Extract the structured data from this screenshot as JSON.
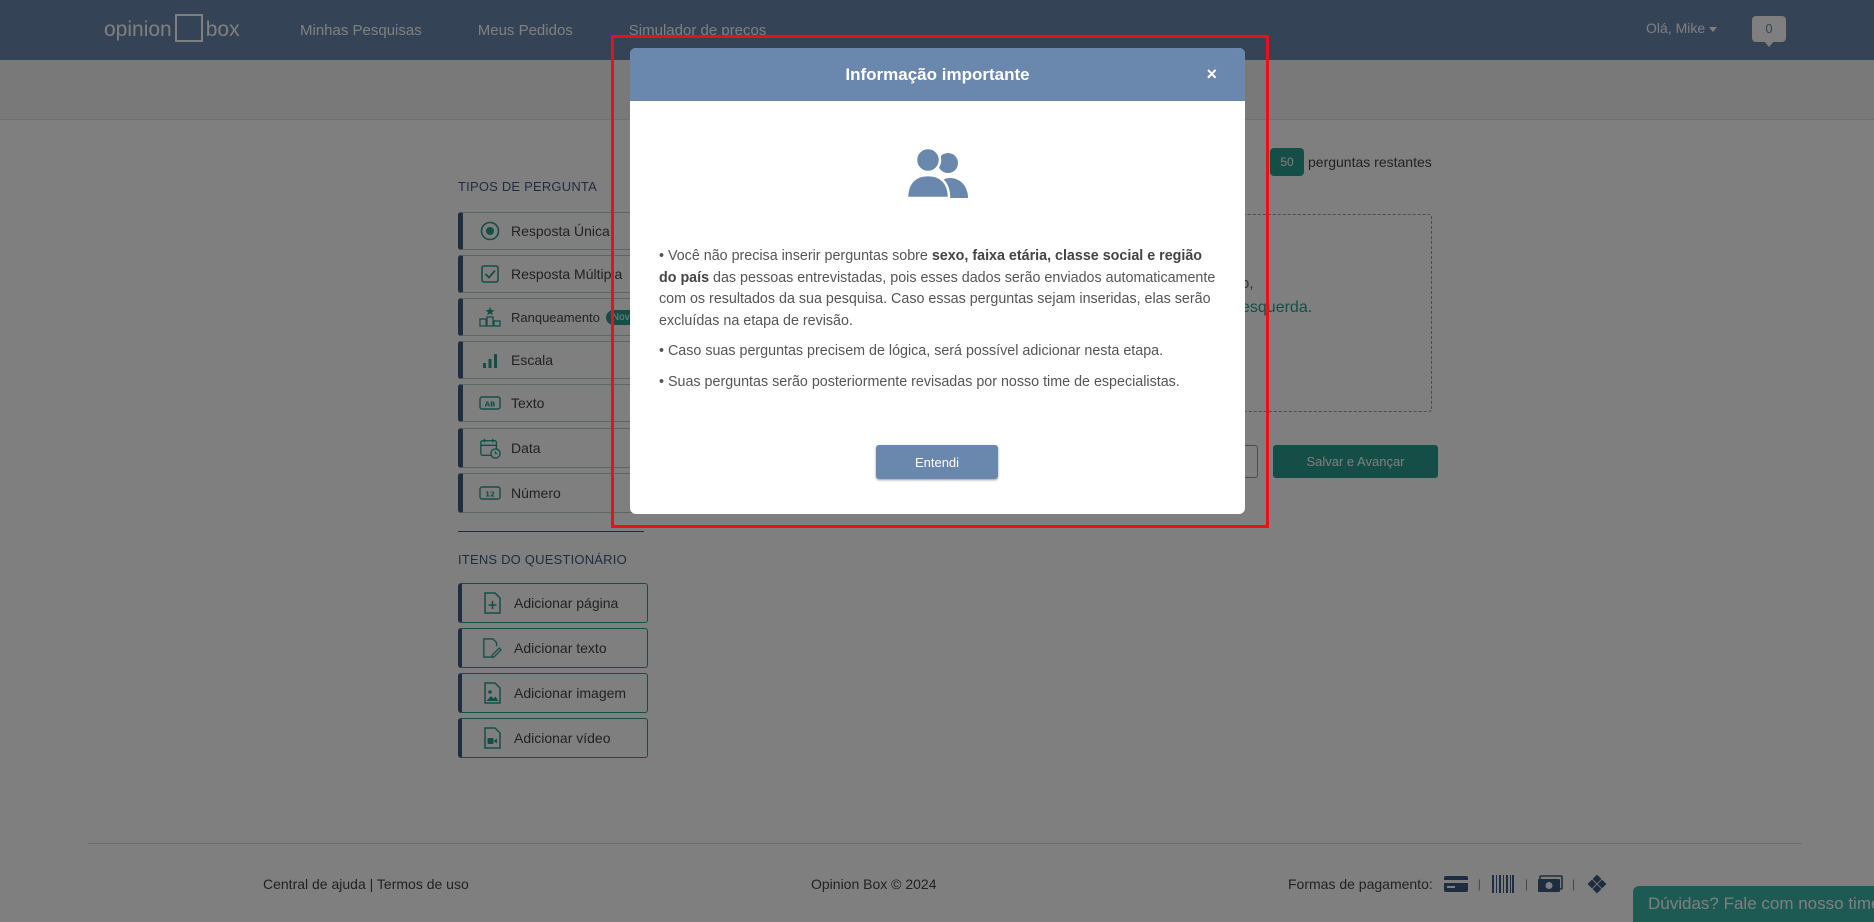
{
  "navbar": {
    "logo_left": "opinion",
    "logo_right": "box",
    "links": [
      "Minhas Pesquisas",
      "Meus Pedidos",
      "Simulador de preços"
    ],
    "user_greeting": "Olá, Mike",
    "notification_count": "0"
  },
  "left_panel": {
    "question_types_title": "TIPOS DE PERGUNTA",
    "question_types": [
      {
        "label": "Resposta Única",
        "icon": "radio-icon"
      },
      {
        "label": "Resposta Múltipla",
        "icon": "checkbox-icon"
      },
      {
        "label": "Ranqueamento",
        "icon": "ranking-icon",
        "badge": "Nov"
      },
      {
        "label": "Escala",
        "icon": "bar-chart-icon"
      },
      {
        "label": "Texto",
        "icon": "text-field-icon"
      },
      {
        "label": "Data",
        "icon": "calendar-icon"
      },
      {
        "label": "Número",
        "icon": "number-icon"
      }
    ],
    "items_title": "ITENS DO QUESTIONÁRIO",
    "items": [
      {
        "label": "Adicionar página",
        "icon": "add-page-icon"
      },
      {
        "label": "Adicionar texto",
        "icon": "edit-text-icon"
      },
      {
        "label": "Adicionar imagem",
        "icon": "image-file-icon"
      },
      {
        "label": "Adicionar vídeo",
        "icon": "video-file-icon"
      }
    ]
  },
  "main": {
    "remaining_count": "50",
    "remaining_label": "perguntas restantes",
    "dropzone_line1": "o,",
    "dropzone_line2": "esquerda.",
    "save_button": "Salvar e Avançar"
  },
  "footer": {
    "help_link": "Central de ajuda",
    "separator": "|",
    "terms_link": "Termos de uso",
    "copyright": "Opinion Box © 2024",
    "payment_label": "Formas de pagamento:",
    "payment_icons": [
      "credit-card-icon",
      "barcode-icon",
      "cash-icon",
      "pix-icon"
    ],
    "help_chat": "Dúvidas? Fale com nosso time"
  },
  "modal": {
    "title": "Informação importante",
    "close": "×",
    "p1_before": "• Você não precisa inserir perguntas sobre ",
    "p1_bold": "sexo, faixa etária, classe social e região do país",
    "p1_after": " das pessoas entrevistadas, pois esses dados serão enviados automaticamente com os resultados da sua pesquisa. Caso essas perguntas sejam inseridas, elas serão excluídas na etapa de revisão.",
    "p2": "• Caso suas perguntas precisem de lógica, será possível adicionar nesta etapa.",
    "p3": "• Suas perguntas serão posteriormente revisadas por nosso time de especialistas.",
    "button": "Entendi"
  },
  "colors": {
    "navbar": "#6a87ae",
    "accent": "#2a9d8f",
    "highlight": "#e8101a"
  }
}
